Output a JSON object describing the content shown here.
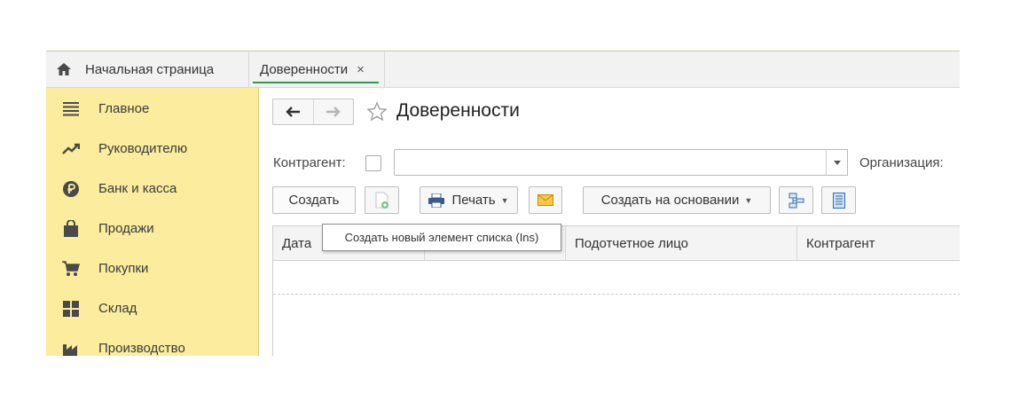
{
  "tabs": {
    "home_label": "Начальная страница",
    "active_label": "Доверенности",
    "close_symbol": "×"
  },
  "sidebar": {
    "items": [
      {
        "label": "Главное",
        "icon": "menu-lines-icon"
      },
      {
        "label": "Руководителю",
        "icon": "trend-up-icon"
      },
      {
        "label": "Банк и касса",
        "icon": "ruble-coin-icon"
      },
      {
        "label": "Продажи",
        "icon": "shopping-bag-icon"
      },
      {
        "label": "Покупки",
        "icon": "cart-icon"
      },
      {
        "label": "Склад",
        "icon": "warehouse-grid-icon"
      },
      {
        "label": "Производство",
        "icon": "factory-icon"
      }
    ],
    "color": "#fbec9e"
  },
  "main": {
    "title": "Доверенности",
    "filter": {
      "counterparty_label": "Контрагент:",
      "counterparty_value": "",
      "organization_label": "Организация:"
    },
    "toolbar": {
      "create_label": "Создать",
      "print_label": "Печать",
      "create_based_label": "Создать на основании"
    },
    "table": {
      "columns": [
        "Дата",
        "",
        "Подотчетное лицо",
        "Контрагент"
      ]
    },
    "tooltip": "Создать новый элемент списка (Ins)"
  },
  "colors": {
    "accent_green": "#2e9a4a",
    "mail_icon": "#f2a900",
    "struct_icon": "#2b6cb0"
  }
}
